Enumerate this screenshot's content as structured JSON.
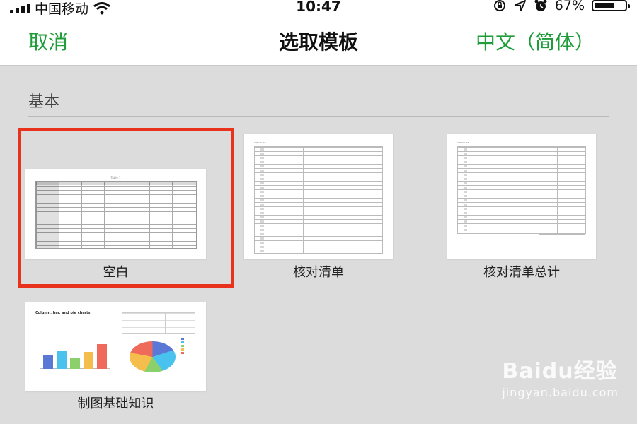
{
  "status_bar": {
    "carrier": "中国移动",
    "time": "10:47",
    "battery": "67%",
    "battery_level": 0.67,
    "icons": [
      "signal-icon",
      "wifi-icon",
      "orientation-lock-icon",
      "location-icon",
      "alarm-icon",
      "battery-icon"
    ]
  },
  "nav": {
    "cancel_label": "取消",
    "title": "选取模板",
    "language_label": "中文（简体）"
  },
  "section": {
    "title": "基本"
  },
  "templates": [
    {
      "label": "空白",
      "selected": true,
      "preview_title": "Table 1"
    },
    {
      "label": "核对清单",
      "selected": false,
      "preview_title": "CHECKLIST"
    },
    {
      "label": "核对清单总计",
      "selected": false,
      "preview_title": "CHECKLIST"
    },
    {
      "label": "制图基础知识",
      "selected": false,
      "preview_title": "Column, bar, and pie charts"
    }
  ],
  "colors": {
    "accent": "#1f9d3a",
    "selection": "#e8321c",
    "background": "#dcdcdc"
  },
  "watermark": {
    "brand": "Baidu经验",
    "url": "jingyan.baidu.com"
  }
}
